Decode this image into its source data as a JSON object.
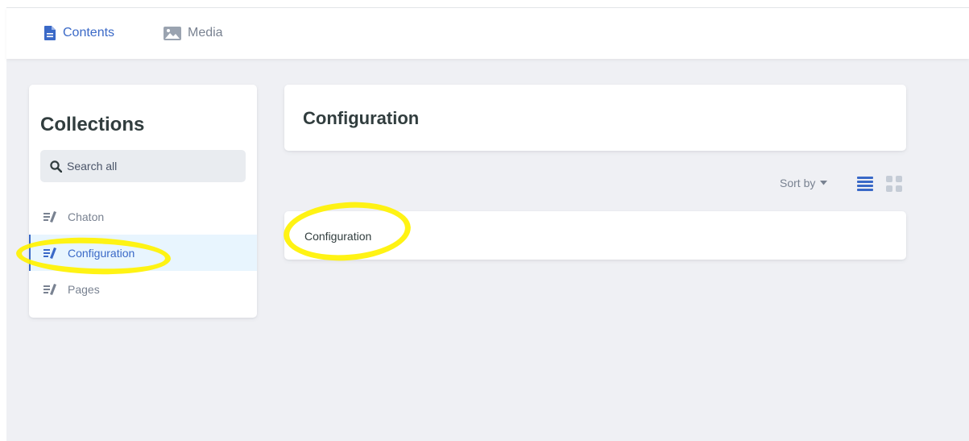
{
  "topnav": {
    "tabs": [
      {
        "label": "Contents",
        "icon": "document-icon",
        "active": true
      },
      {
        "label": "Media",
        "icon": "image-icon",
        "active": false
      }
    ]
  },
  "sidebar": {
    "title": "Collections",
    "search": {
      "placeholder": "Search all",
      "icon": "search-icon"
    },
    "items": [
      {
        "label": "Chaton",
        "icon": "collection-icon",
        "active": false
      },
      {
        "label": "Configuration",
        "icon": "collection-icon",
        "active": true
      },
      {
        "label": "Pages",
        "icon": "collection-icon",
        "active": false
      }
    ]
  },
  "main": {
    "header_title": "Configuration",
    "sort_label": "Sort by",
    "view_modes": [
      {
        "name": "list",
        "icon": "list-view-icon",
        "active": true
      },
      {
        "name": "grid",
        "icon": "grid-view-icon",
        "active": false
      }
    ],
    "entries": [
      {
        "title": "Configuration"
      }
    ]
  },
  "colors": {
    "accent": "#3a69c7",
    "background": "#eff0f4",
    "annotation_highlight": "#fff200"
  }
}
